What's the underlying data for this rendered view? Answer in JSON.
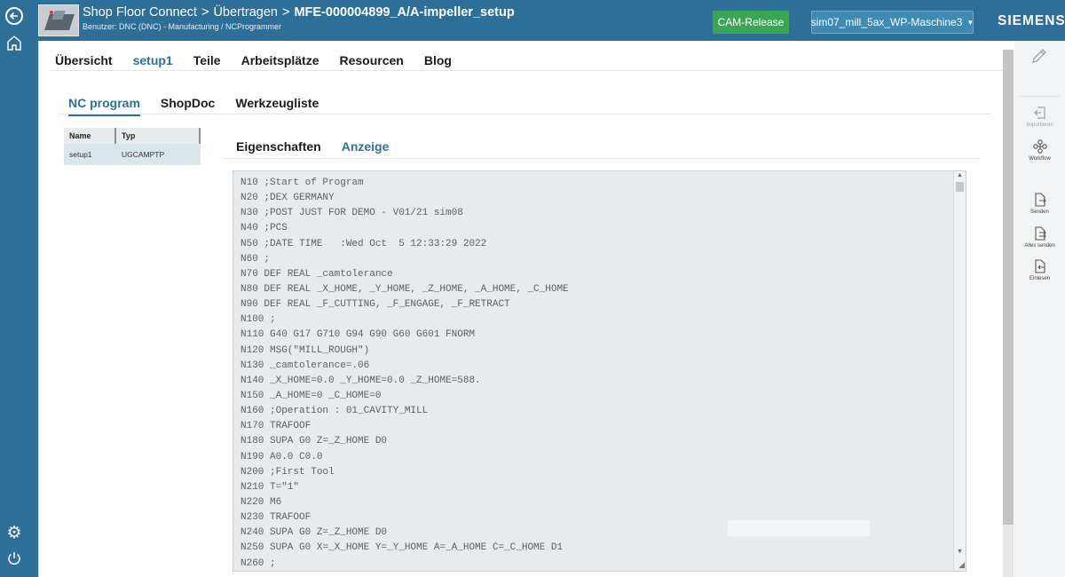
{
  "header": {
    "app_title": "Shop Floor Connect",
    "separator": ">",
    "crumb_2": "Übertragen",
    "crumb_3": "MFE-000004899_A/A-impeller_setup",
    "user_line": "Benutzer: DNC (DNC) - Manufacturing / NCProgrammer",
    "cam_release_label": "CAM-Release",
    "machine_label": "sim07_mill_5ax_WP-Maschine3",
    "brand": "SIEMENS"
  },
  "main_tabs": [
    {
      "label": "Übersicht",
      "active": false
    },
    {
      "label": "setup1",
      "active": true
    },
    {
      "label": "Teile",
      "active": false
    },
    {
      "label": "Arbeitsplätze",
      "active": false
    },
    {
      "label": "Resourcen",
      "active": false
    },
    {
      "label": "Blog",
      "active": false
    }
  ],
  "sub_tabs": [
    {
      "label": "NC program",
      "active": true
    },
    {
      "label": "ShopDoc",
      "active": false
    },
    {
      "label": "Werkzeugliste",
      "active": false
    }
  ],
  "program_list": {
    "headers": [
      "Name",
      "Typ"
    ],
    "rows": [
      {
        "name": "setup1",
        "typ": "UGCAMPTP"
      }
    ]
  },
  "detail_tabs": [
    {
      "label": "Eigenschaften",
      "active": false
    },
    {
      "label": "Anzeige",
      "active": true
    }
  ],
  "code_lines": [
    "N10 ;Start of Program",
    "N20 ;DEX GERMANY",
    "N30 ;POST JUST FOR DEMO - V01/21 sim08",
    "N40 ;PCS",
    "N50 ;DATE TIME   :Wed Oct  5 12:33:29 2022",
    "N60 ;",
    "N70 DEF REAL _camtolerance",
    "N80 DEF REAL _X_HOME, _Y_HOME, _Z_HOME, _A_HOME, _C_HOME",
    "N90 DEF REAL _F_CUTTING, _F_ENGAGE, _F_RETRACT",
    "N100 ;",
    "N110 G40 G17 G710 G94 G90 G60 G601 FNORM",
    "N120 MSG(\"MILL_ROUGH\")",
    "N130 _camtolerance=.06",
    "N140 _X_HOME=0.0 _Y_HOME=0.0 _Z_HOME=588.",
    "N150 _A_HOME=0 _C_HOME=0",
    "N160 ;Operation : 01_CAVITY_MILL",
    "N170 TRAFOOF",
    "N180 SUPA G0 Z=_Z_HOME D0",
    "N190 A0.0 C0.0",
    "N200 ;First Tool",
    "N210 T=\"1\"",
    "N220 M6",
    "N230 TRAFOOF",
    "N240 SUPA G0 Z=_Z_HOME D0",
    "N250 SUPA G0 X=_X_HOME Y=_Y_HOME A=_A_HOME C=_C_HOME D1",
    "N260 ;"
  ],
  "right_panel": {
    "import_label": "Importieren",
    "workflow_label": "Workflow",
    "send_label": "Senden",
    "send_all_label": "Alles senden",
    "read_in_label": "Einlesen"
  },
  "colors": {
    "header_bg": "#2e6f9a",
    "accent": "#2d6f99",
    "cam_release": "#3aa655"
  }
}
